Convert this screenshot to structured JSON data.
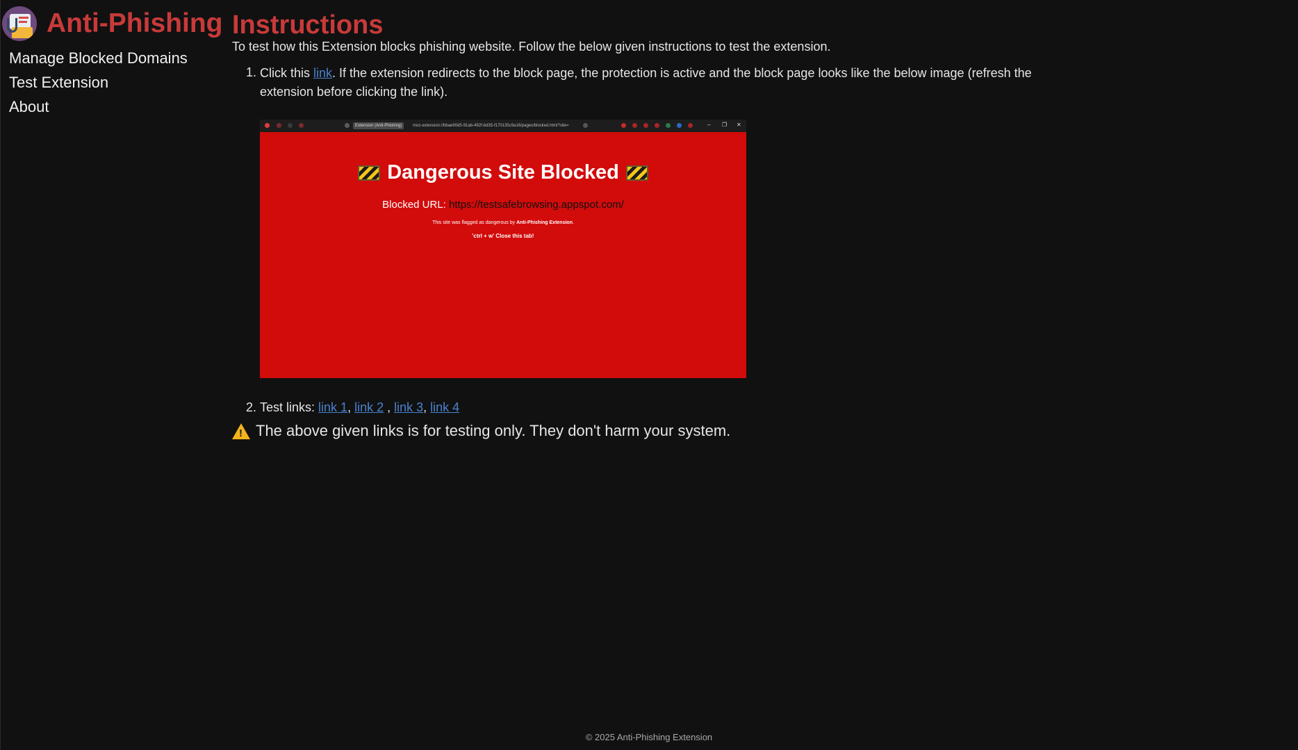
{
  "app": {
    "title": "Anti-Phishing"
  },
  "sidebar": {
    "items": [
      {
        "label": "Manage Blocked Domains"
      },
      {
        "label": "Test Extension"
      },
      {
        "label": "About"
      }
    ]
  },
  "main": {
    "title": "Instructions",
    "intro": "To test how this Extension blocks phishing website. Follow the below given instructions to test the extension.",
    "step1": {
      "number": "1.",
      "prefix": "Click this ",
      "link_label": "link",
      "suffix": ". If the extension redirects to the block page, the protection is active and the block page looks like the below image (refresh the extension before clicking the link)."
    },
    "screenshot": {
      "tab_label": "Extension (Anti-Phishing)",
      "address": "moz-extension://bbae90d5-91ab-492f-bd35-f170135c9a16/pages/blocked.html?site=",
      "heading": "Dangerous Site Blocked",
      "url_label": "Blocked URL:",
      "url_value": "https://testsafebrowsing.appspot.com/",
      "note_prefix": "This site was flagged as dangerous by ",
      "note_bold": "Anti-Phishing Extension",
      "note_suffix": ".",
      "close_hint": "'ctrl + w' Close this tab!",
      "bg_color": "#d20b0b"
    },
    "step2": {
      "number": "2.",
      "label": "Test links: ",
      "links": [
        "link 1",
        "link 2",
        "link 3",
        "link 4"
      ]
    },
    "warning": "The above given links is for testing only. They don't harm your system."
  },
  "footer": {
    "text": "© 2025 Anti-Phishing Extension"
  },
  "colors": {
    "accent": "#c83a3a",
    "link": "#4a82cf",
    "background": "#111111"
  }
}
